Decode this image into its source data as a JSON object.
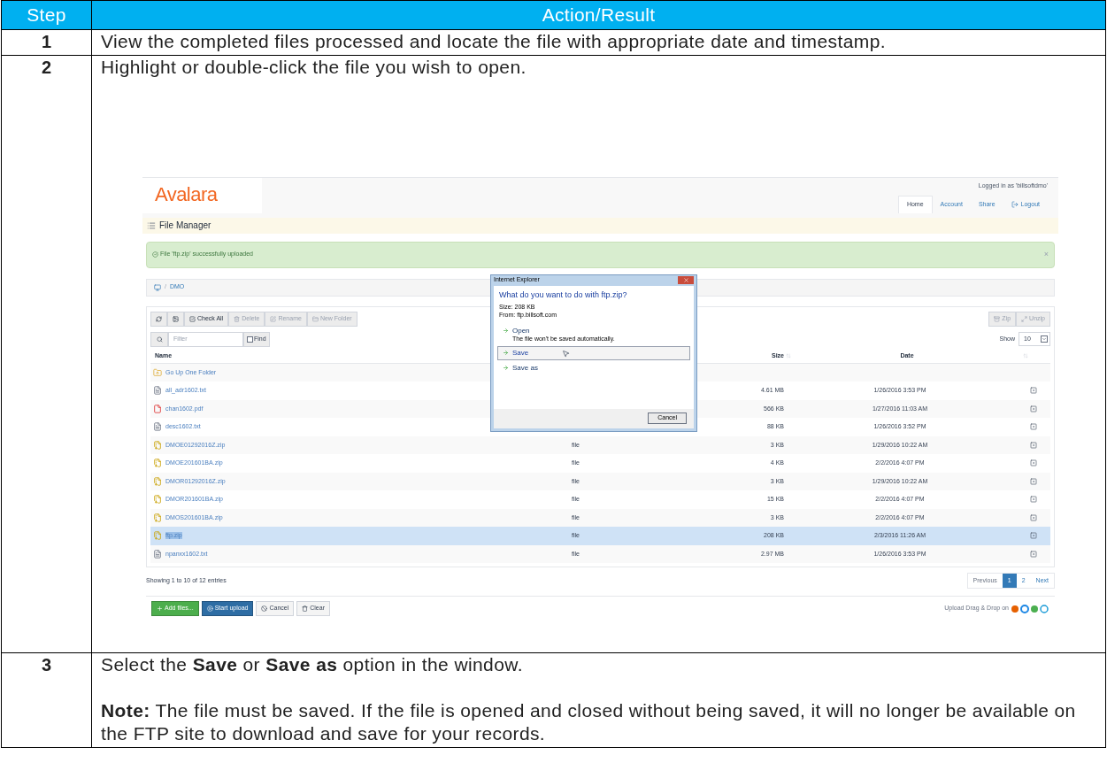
{
  "table": {
    "columns": [
      "Step",
      "Action/Result"
    ],
    "rows": [
      {
        "step": "1",
        "paragraphs": [
          "View the completed files processed and locate the file with appropriate date and timestamp."
        ]
      },
      {
        "step": "2",
        "paragraphs": [
          "Highlight or double-click the file you wish to open."
        ],
        "screenshot": {
          "logo": "Avalara",
          "logged_in": "Logged in as 'billsoftdmo'",
          "nav": [
            {
              "label": "Home",
              "selected": true
            },
            {
              "label": "Account",
              "selected": false
            },
            {
              "label": "Share",
              "selected": false
            },
            {
              "label": "Logout",
              "selected": false
            }
          ],
          "page_title": "File Manager",
          "alert": {
            "text": "File 'ftp.zip' successfully uploaded",
            "close": "×"
          },
          "breadcrumb": {
            "separator": "/",
            "folder": "DMO"
          },
          "toolbar": [
            {
              "kind": "refresh",
              "disabled": false
            },
            {
              "kind": "image",
              "disabled": false
            },
            {
              "kind": "check",
              "label": "Check All",
              "disabled": false
            },
            {
              "kind": "delete",
              "label": "Delete",
              "disabled": true
            },
            {
              "kind": "rename",
              "label": "Rename",
              "disabled": true
            },
            {
              "kind": "folder",
              "label": "New Folder",
              "disabled": true
            }
          ],
          "toolbar_right": [
            {
              "kind": "zip",
              "label": "Zip",
              "disabled": true
            },
            {
              "kind": "unzip",
              "label": "Unzip",
              "disabled": true
            }
          ],
          "filter": {
            "placeholder": "Filter",
            "find_label": "Find",
            "checked": false
          },
          "show": {
            "label": "Show",
            "value": "10"
          },
          "columns": {
            "name": "Name",
            "size": "Size",
            "date": "Date"
          },
          "rows": [
            {
              "kind": "parent",
              "name": "Go Up One Folder",
              "selected": false
            },
            {
              "kind": "txt",
              "name": "all_adr1602.txt",
              "size": "4.61 MB",
              "date": "1/26/2016 3:53 PM",
              "selected": false
            },
            {
              "kind": "pdf",
              "name": "chan1602.pdf",
              "size": "566 KB",
              "date": "1/27/2016 11:03 AM",
              "selected": false
            },
            {
              "kind": "txt",
              "name": "desc1602.txt",
              "size": "88 KB",
              "date": "1/26/2016 3:52 PM",
              "selected": false
            },
            {
              "kind": "zip",
              "name": "DMOE01292016Z.zip",
              "type": "file",
              "size": "3 KB",
              "date": "1/29/2016 10:22 AM",
              "selected": false
            },
            {
              "kind": "zip",
              "name": "DMOE201601BA.zip",
              "type": "file",
              "size": "4 KB",
              "date": "2/2/2016 4:07 PM",
              "selected": false
            },
            {
              "kind": "zip",
              "name": "DMOR01292016Z.zip",
              "type": "file",
              "size": "3 KB",
              "date": "1/29/2016 10:22 AM",
              "selected": false
            },
            {
              "kind": "zip",
              "name": "DMOR201601BA.zip",
              "type": "file",
              "size": "15 KB",
              "date": "2/2/2016 4:07 PM",
              "selected": false
            },
            {
              "kind": "zip",
              "name": "DMOS201601BA.zip",
              "type": "file",
              "size": "3 KB",
              "date": "2/2/2016 4:07 PM",
              "selected": false
            },
            {
              "kind": "zip",
              "name": "ftp.zip",
              "type": "file",
              "size": "208 KB",
              "date": "2/3/2016 11:26 AM",
              "selected": true
            },
            {
              "kind": "txt",
              "name": "npanxx1602.txt",
              "type": "file",
              "size": "2.97 MB",
              "date": "1/26/2016 3:53 PM",
              "selected": false
            }
          ],
          "entries": "Showing 1 to 10 of 12 entries",
          "pagination": [
            {
              "label": "Previous",
              "selected": false
            },
            {
              "label": "1",
              "selected": true
            },
            {
              "label": "2",
              "selected": false
            },
            {
              "label": "Next",
              "selected": false
            }
          ],
          "upload_buttons": [
            {
              "kind": "add",
              "label": "Add files..."
            },
            {
              "kind": "start",
              "label": "Start upload"
            },
            {
              "kind": "cancel",
              "label": "Cancel"
            },
            {
              "kind": "clear",
              "label": "Clear"
            }
          ],
          "drag_drop": "Upload Drag & Drop on",
          "dialog": {
            "title": "Internet Explorer",
            "question": "What do you want to do with ftp.zip?",
            "size": "Size: 208 KB",
            "from": "From: ftp.billsoft.com",
            "options": [
              {
                "label": "Open",
                "note": "The file won't be saved automatically.",
                "selected": false
              },
              {
                "label": "Save",
                "selected": true
              },
              {
                "label": "Save as",
                "selected": false
              }
            ],
            "cancel": "Cancel"
          }
        }
      },
      {
        "step": "3",
        "paragraphs": [
          "Select the **Save** or **Save as** option in the window.",
          "**Note:** The file must be saved.  If the file is opened and closed without being saved, it will no longer be available on the FTP site to download and save for your records."
        ]
      }
    ]
  }
}
